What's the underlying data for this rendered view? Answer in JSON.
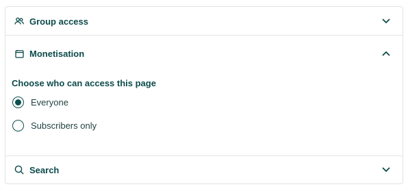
{
  "colors": {
    "accent": "#0d4f4f",
    "border": "#dfe3e3",
    "text": "#1f3f3f"
  },
  "sections": {
    "group_access": {
      "title": "Group access",
      "icon": "people-icon",
      "state": "collapsed"
    },
    "monetisation": {
      "title": "Monetisation",
      "icon": "card-icon",
      "state": "expanded",
      "question": "Choose who can access this page",
      "options": [
        {
          "label": "Everyone",
          "selected": true
        },
        {
          "label": "Subscribers only",
          "selected": false
        }
      ]
    },
    "search": {
      "title": "Search",
      "icon": "search-icon",
      "state": "collapsed"
    }
  }
}
